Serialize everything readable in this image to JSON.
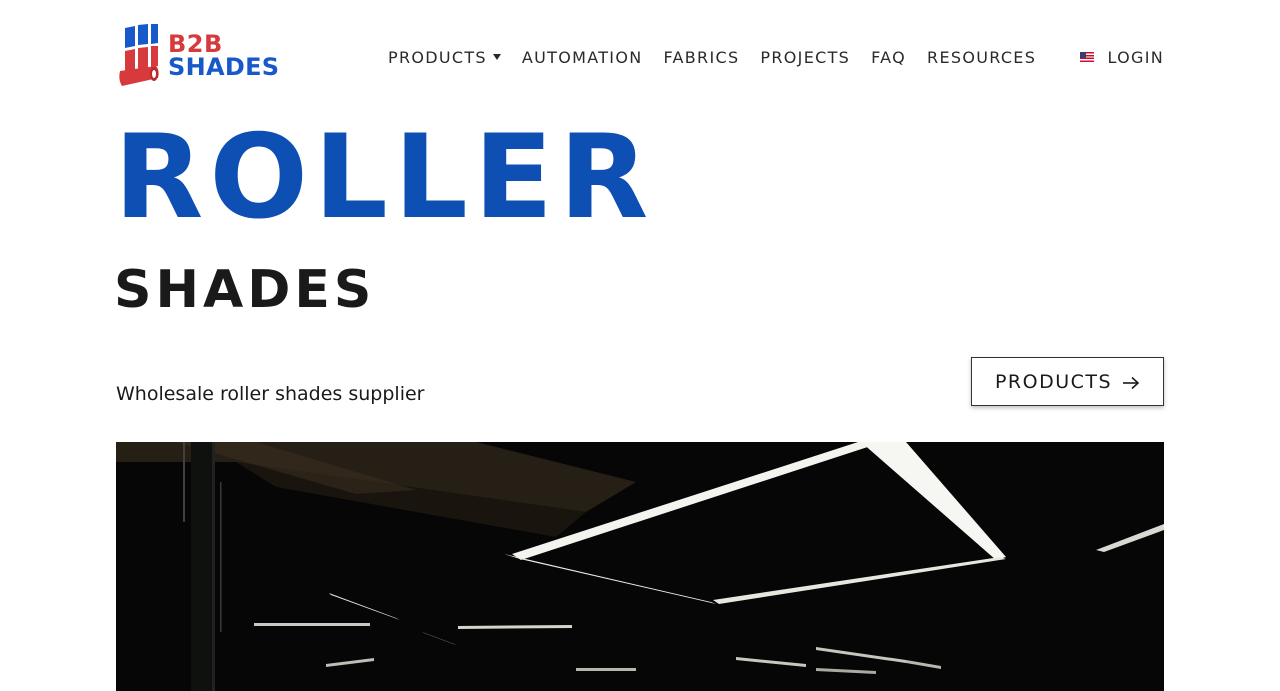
{
  "brand": {
    "line1": "B2B",
    "line2": "SHADES",
    "colors": {
      "red": "#d63a3c",
      "blue": "#1759c9"
    }
  },
  "nav": {
    "items": [
      {
        "label": "PRODUCTS",
        "has_dropdown": true
      },
      {
        "label": "AUTOMATION",
        "has_dropdown": false
      },
      {
        "label": "FABRICS",
        "has_dropdown": false
      },
      {
        "label": "PROJECTS",
        "has_dropdown": false
      },
      {
        "label": "FAQ",
        "has_dropdown": false
      },
      {
        "label": "RESOURCES",
        "has_dropdown": false
      }
    ]
  },
  "header": {
    "flag_icon": "us-flag-icon",
    "login_label": "LOGIN"
  },
  "hero": {
    "title": "ROLLER",
    "subtitle": "SHADES",
    "tagline": "Wholesale roller shades supplier",
    "cta_label": "PRODUCTS",
    "cta_icon": "arrow-right-icon",
    "title_color": "#0d4fb3"
  }
}
